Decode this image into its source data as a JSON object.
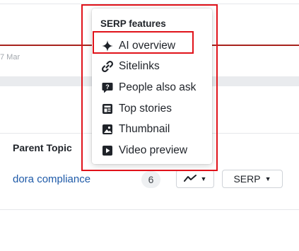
{
  "chart": {
    "date_label": "7 Mar"
  },
  "table": {
    "column_header": "Parent Topic",
    "row": {
      "topic": "dora compliance",
      "count": "6",
      "serp_button_label": "SERP"
    }
  },
  "serp_popup": {
    "title": "SERP features",
    "items": [
      {
        "label": "AI overview",
        "icon": "sparkle-icon"
      },
      {
        "label": "Sitelinks",
        "icon": "link-icon"
      },
      {
        "label": "People also ask",
        "icon": "question-bubble-icon"
      },
      {
        "label": "Top stories",
        "icon": "news-icon"
      },
      {
        "label": "Thumbnail",
        "icon": "image-icon"
      },
      {
        "label": "Video preview",
        "icon": "play-icon"
      }
    ]
  },
  "colors": {
    "highlight": "#e0121a",
    "trend_line": "#a8231d",
    "link": "#1e5aa8"
  }
}
